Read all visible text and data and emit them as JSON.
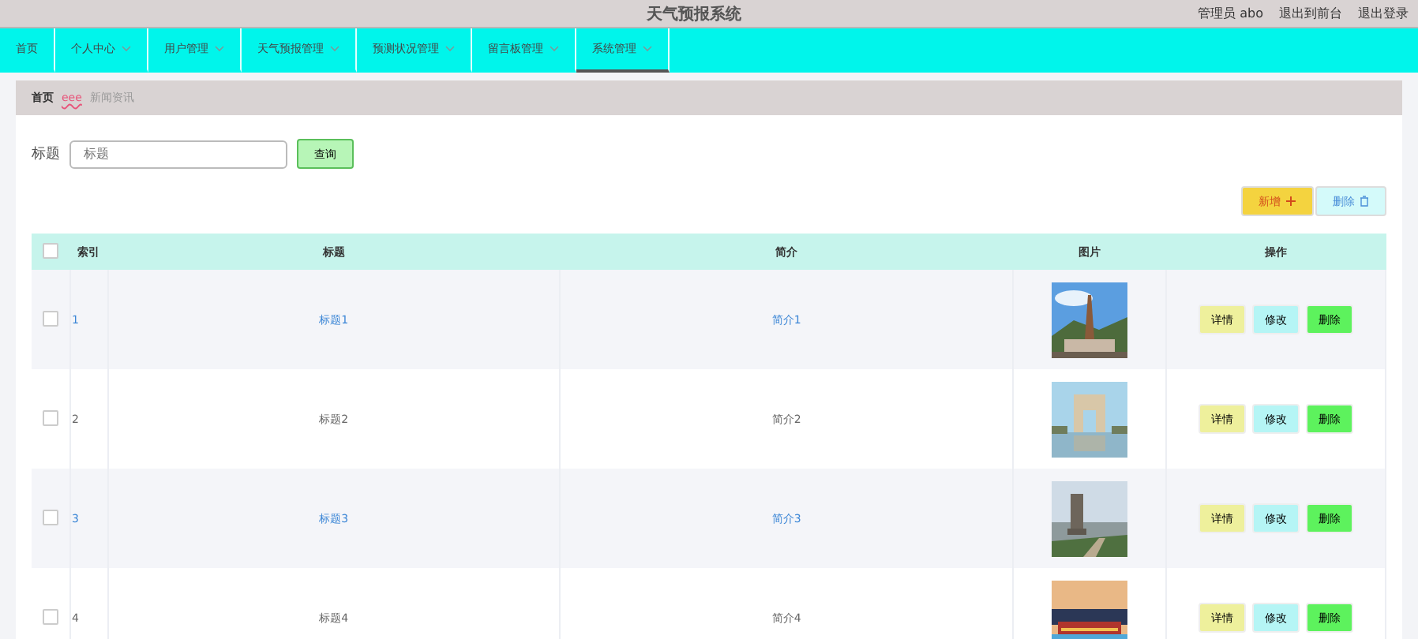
{
  "header": {
    "title": "天气预报系统",
    "user": "管理员 abo",
    "links": [
      "退出到前台",
      "退出登录"
    ]
  },
  "nav": [
    {
      "label": "首页",
      "dropdown": false,
      "selected": false
    },
    {
      "label": "个人中心",
      "dropdown": true,
      "selected": false
    },
    {
      "label": "用户管理",
      "dropdown": true,
      "selected": false
    },
    {
      "label": "天气预报管理",
      "dropdown": true,
      "selected": false
    },
    {
      "label": "预测状况管理",
      "dropdown": true,
      "selected": false
    },
    {
      "label": "留言板管理",
      "dropdown": true,
      "selected": false
    },
    {
      "label": "系统管理",
      "dropdown": true,
      "selected": true
    }
  ],
  "breadcrumb": {
    "home": "首页",
    "separator": "eee",
    "current": "新闻资讯"
  },
  "search": {
    "label": "标题",
    "placeholder": "标题",
    "button": "查询"
  },
  "actions": {
    "add": "新增",
    "delete": "删除"
  },
  "table": {
    "select_all_checked": false,
    "columns": [
      "索引",
      "标题",
      "简介",
      "图片",
      "操作"
    ],
    "rows": [
      {
        "index": "1",
        "title": "标题1",
        "intro": "简介1",
        "link": true,
        "checked": false,
        "image": {
          "kind": "picture"
        },
        "buttons": [
          "详情",
          "修改",
          "删除"
        ]
      },
      {
        "index": "2",
        "title": "标题2",
        "intro": "简介2",
        "link": false,
        "checked": false,
        "image": {
          "kind": "picture"
        },
        "buttons": [
          "详情",
          "修改",
          "删除"
        ]
      },
      {
        "index": "3",
        "title": "标题3",
        "intro": "简介3",
        "link": true,
        "checked": false,
        "image": {
          "kind": "picture"
        },
        "buttons": [
          "详情",
          "修改",
          "删除"
        ]
      },
      {
        "index": "4",
        "title": "标题4",
        "intro": "简介4",
        "link": false,
        "checked": false,
        "image": {
          "kind": "picture"
        },
        "buttons": [
          "详情",
          "修改",
          "删除"
        ]
      }
    ]
  }
}
